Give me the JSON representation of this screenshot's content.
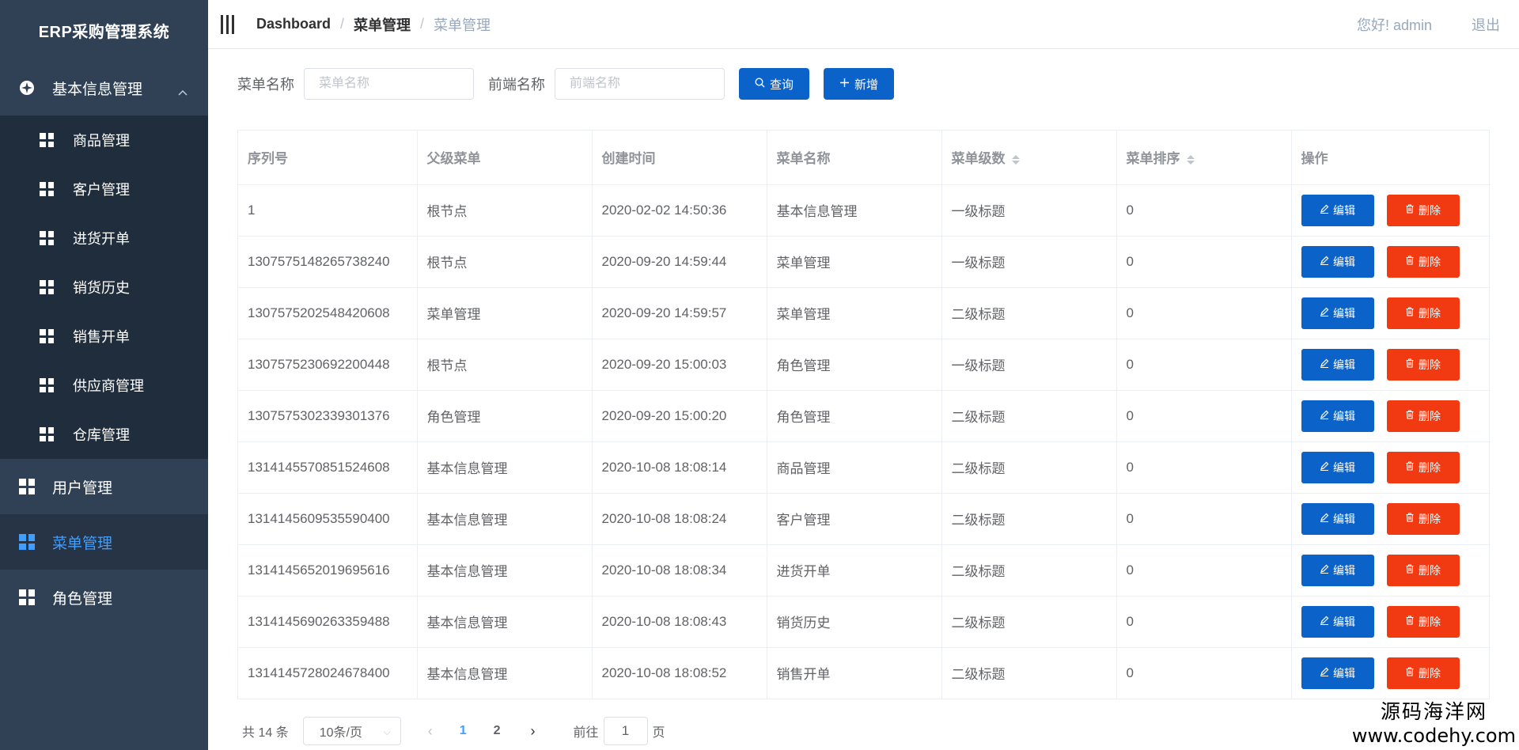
{
  "app": {
    "title": "ERP采购管理系统"
  },
  "sidebar": {
    "group": {
      "label": "基本信息管理"
    },
    "sub_items": [
      {
        "label": "商品管理"
      },
      {
        "label": "客户管理"
      },
      {
        "label": "进货开单"
      },
      {
        "label": "销货历史"
      },
      {
        "label": "销售开单"
      },
      {
        "label": "供应商管理"
      },
      {
        "label": "仓库管理"
      }
    ],
    "items": [
      {
        "label": "用户管理"
      },
      {
        "label": "菜单管理"
      },
      {
        "label": "角色管理"
      }
    ],
    "active_color": "#409eff"
  },
  "header": {
    "breadcrumb": [
      "Dashboard",
      "菜单管理",
      "菜单管理"
    ],
    "greeting": "您好!  admin",
    "logout": "退出"
  },
  "search": {
    "menu_name_label": "菜单名称",
    "menu_name_placeholder": "菜单名称",
    "frontend_name_label": "前端名称",
    "frontend_name_placeholder": "前端名称",
    "query_button": "查询",
    "add_button": "新增"
  },
  "table": {
    "columns": [
      "序列号",
      "父级菜单",
      "创建时间",
      "菜单名称",
      "菜单级数",
      "菜单排序",
      "操作"
    ],
    "edit_label": "编辑",
    "delete_label": "删除",
    "rows": [
      [
        "1",
        "根节点",
        "2020-02-02 14:50:36",
        "基本信息管理",
        "一级标题",
        "0"
      ],
      [
        "1307575148265738240",
        "根节点",
        "2020-09-20 14:59:44",
        "菜单管理",
        "一级标题",
        "0"
      ],
      [
        "1307575202548420608",
        "菜单管理",
        "2020-09-20 14:59:57",
        "菜单管理",
        "二级标题",
        "0"
      ],
      [
        "1307575230692200448",
        "根节点",
        "2020-09-20 15:00:03",
        "角色管理",
        "一级标题",
        "0"
      ],
      [
        "1307575302339301376",
        "角色管理",
        "2020-09-20 15:00:20",
        "角色管理",
        "二级标题",
        "0"
      ],
      [
        "1314145570851524608",
        "基本信息管理",
        "2020-10-08 18:08:14",
        "商品管理",
        "二级标题",
        "0"
      ],
      [
        "1314145609535590400",
        "基本信息管理",
        "2020-10-08 18:08:24",
        "客户管理",
        "二级标题",
        "0"
      ],
      [
        "1314145652019695616",
        "基本信息管理",
        "2020-10-08 18:08:34",
        "进货开单",
        "二级标题",
        "0"
      ],
      [
        "1314145690263359488",
        "基本信息管理",
        "2020-10-08 18:08:43",
        "销货历史",
        "二级标题",
        "0"
      ],
      [
        "1314145728024678400",
        "基本信息管理",
        "2020-10-08 18:08:52",
        "销售开单",
        "二级标题",
        "0"
      ]
    ]
  },
  "pager": {
    "total": "共 14 条",
    "page_size": "10条/页",
    "pages": [
      "1",
      "2"
    ],
    "goto_prefix": "前往",
    "goto_value": "1",
    "goto_suffix": "页"
  },
  "watermark": {
    "line1": "源码海洋网",
    "line2": "www.codehy.com"
  },
  "colors": {
    "sidebar_bg": "#304156",
    "primary_button": "#0b62c9",
    "danger_button": "#f23a12"
  }
}
